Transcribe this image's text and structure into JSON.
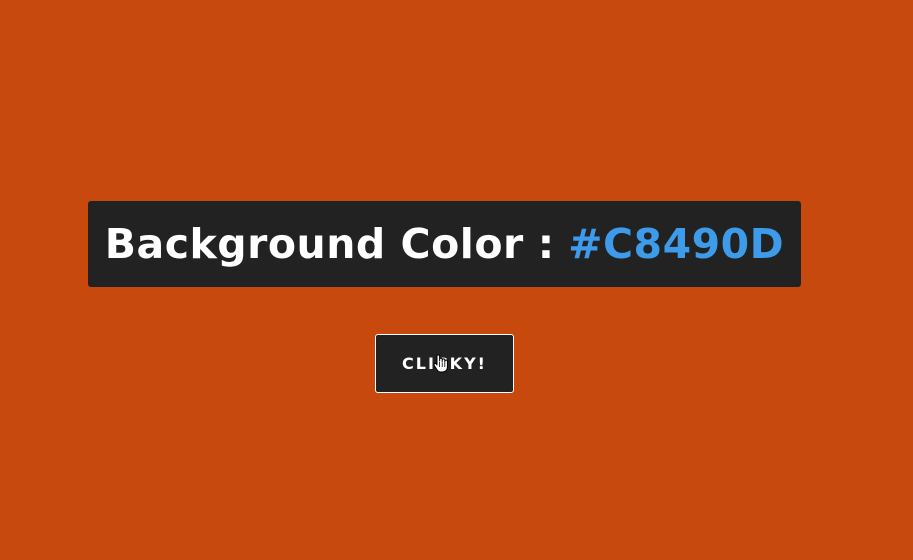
{
  "colors": {
    "page_background": "#C8490D",
    "box_background": "#222222",
    "label_color": "#FFFFFF",
    "value_color": "#3D9BE9"
  },
  "display": {
    "label": "Background Color",
    "separator": ":",
    "value": "#C8490D"
  },
  "button": {
    "label": "CLICKY!"
  },
  "cursor": {
    "icon": "hand-pointer-icon"
  }
}
